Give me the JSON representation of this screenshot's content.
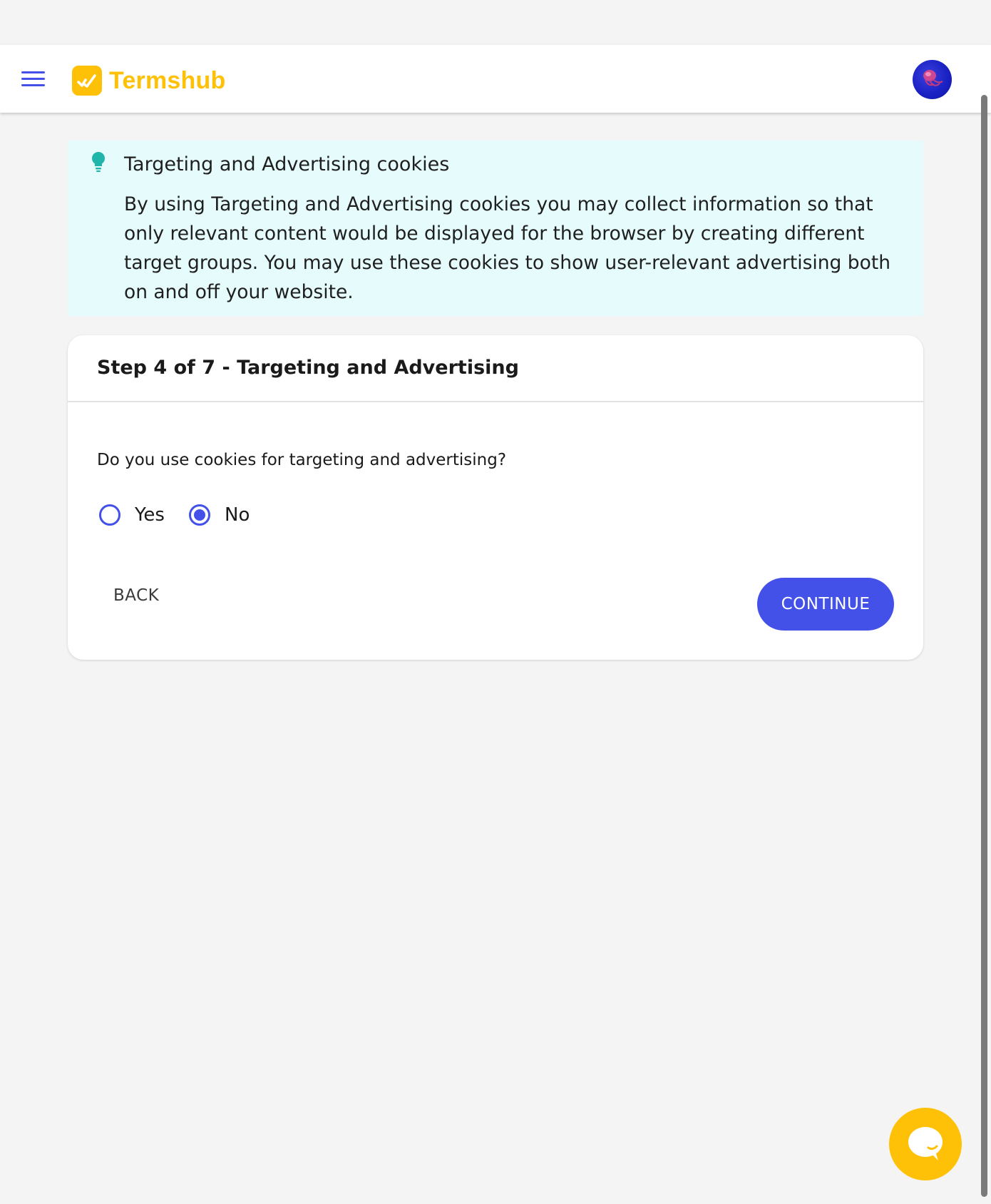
{
  "header": {
    "brand_name": "Termshub",
    "brand_color": "#ffc107",
    "menu_icon": "hamburger-menu-icon",
    "avatar_icon": "user-avatar"
  },
  "info": {
    "icon": "lightbulb-icon",
    "title": "Targeting and Advertising cookies",
    "text": "By using Targeting and Advertising cookies you may collect information so that only relevant content would be displayed for the browser by creating different target groups. You may use these cookies to show user-relevant advertising both on and off your website."
  },
  "step": {
    "title": "Step 4 of 7 - Targeting and Advertising",
    "question": "Do you use cookies for targeting and advertising?",
    "options": [
      {
        "label": "Yes",
        "selected": false
      },
      {
        "label": "No",
        "selected": true
      }
    ],
    "back_label": "BACK",
    "continue_label": "CONTINUE"
  },
  "colors": {
    "accent": "#4351e8",
    "info_background": "#e6fcfc",
    "page_background": "#f4f4f4"
  },
  "chat": {
    "icon": "chat-bubble-icon"
  }
}
